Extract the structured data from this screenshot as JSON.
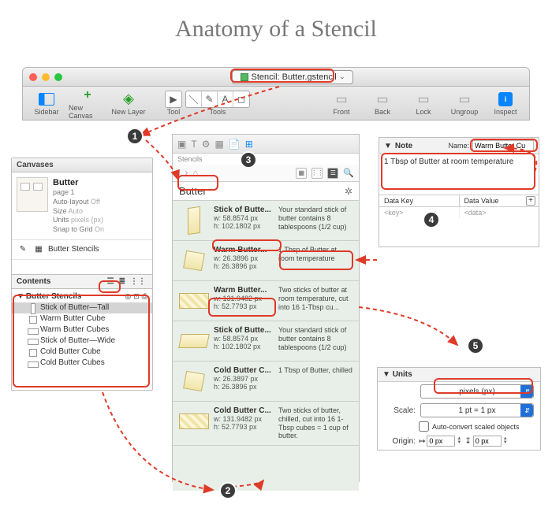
{
  "page": {
    "title": "Anatomy of a Stencil"
  },
  "callouts": [
    "1",
    "2",
    "3",
    "4",
    "5"
  ],
  "titlebar": {
    "doc_label": "Stencil: Butter.gstencil"
  },
  "toolbar": {
    "sidebar": "Sidebar",
    "new_canvas": "New Canvas",
    "new_layer": "New Layer",
    "tool": "Tool",
    "tools": "Tools",
    "front": "Front",
    "back": "Back",
    "lock": "Lock",
    "ungroup": "Ungroup",
    "inspect": "Inspect"
  },
  "canvases": {
    "header": "Canvases",
    "canvas": {
      "name": "Butter",
      "page": "page 1",
      "autolayout_lbl": "Auto-layout",
      "autolayout_val": "Off",
      "size_lbl": "Size",
      "size_val": "Auto",
      "units_lbl": "Units",
      "units_val": "pixels (px)",
      "snap_lbl": "Snap to Grid",
      "snap_val": "On"
    },
    "sublayer": "Butter Stencils",
    "contents_header": "Contents",
    "tree_header": "Butter Stencils",
    "items": [
      "Stick of Butter—Tall",
      "Warm Butter Cube",
      "Warm Butter Cubes",
      "Stick of Butter—Wide",
      "Cold Butter Cube",
      "Cold Butter Cubes"
    ]
  },
  "stencils": {
    "tab_label": "Stencils",
    "breadcrumb": "Butter",
    "rows": [
      {
        "title": "Stick of Butte...",
        "w": "w: 58.8574 px",
        "h": "h: 102.1802 px",
        "desc": "Your standard stick of butter contains 8 tablespoons (1/2 cup)"
      },
      {
        "title": "Warm Butter...",
        "w": "w: 26.3896 px",
        "h": "h: 26.3896 px",
        "desc": "1 Tbsp of Butter at room temperature"
      },
      {
        "title": "Warm Butter...",
        "w": "w: 131.9482 px",
        "h": "h: 52.7793 px",
        "desc": "Two sticks of butter at room temperature, cut into 16 1-Tbsp cu..."
      },
      {
        "title": "Stick of Butte...",
        "w": "w: 58.8574 px",
        "h": "h: 102.1802 px",
        "desc": "Your standard stick of butter contains 8 tablespoons (1/2 cup)"
      },
      {
        "title": "Cold Butter C...",
        "w": "w: 26.3897 px",
        "h": "h: 26.3896 px",
        "desc": "1 Tbsp of Butter, chilled"
      },
      {
        "title": "Cold Butter C...",
        "w": "w: 131.9482 px",
        "h": "h: 52.7793 px",
        "desc": "Two sticks of butter, chilled, cut into 16 1-Tbsp cubes = 1 cup of butter."
      }
    ]
  },
  "note": {
    "header": "Note",
    "name_lbl": "Name:",
    "name_val": "Warm Butter Cu",
    "body": "1 Tbsp of Butter at room temperature",
    "datakey_h": "Data Key",
    "dataval_h": "Data Value",
    "key_ph": "<key>",
    "val_ph": "<data>"
  },
  "units": {
    "header": "Units",
    "unit_val": "pixels (px)",
    "scale_lbl": "Scale:",
    "scale_val": "1 pt = 1 px",
    "autoconv": "Auto-convert scaled objects",
    "origin_lbl": "Origin:",
    "ox": "0 px",
    "oy": "0 px"
  }
}
